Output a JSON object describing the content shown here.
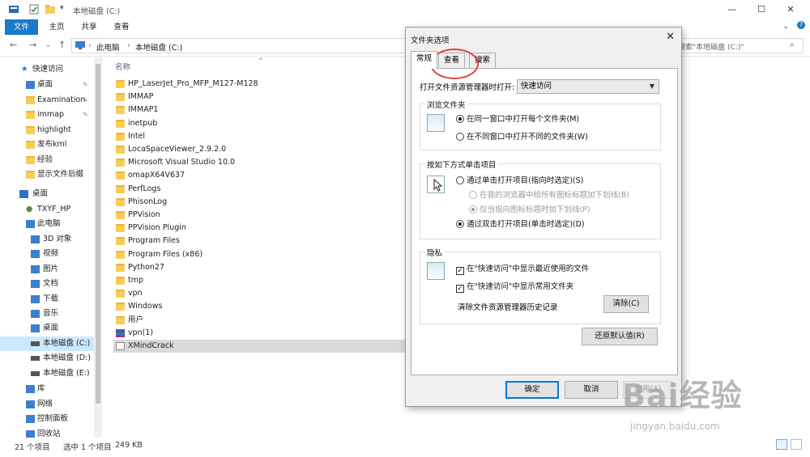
{
  "window": {
    "title": "本地磁盘 (C:)",
    "controls": [
      "—",
      "☐",
      "✕"
    ]
  },
  "ribbon": {
    "tabs": [
      "文件",
      "主页",
      "共享",
      "查看"
    ]
  },
  "address": {
    "crumbs": [
      "此电脑",
      "本地磁盘 (C:)"
    ],
    "search_placeholder": "搜索\"本地磁盘 (C:)\""
  },
  "nav": {
    "quick_access": "快速访问",
    "items": [
      {
        "label": "桌面",
        "pinned": true,
        "icon": "desktop-icon"
      },
      {
        "label": "Examination",
        "pinned": true,
        "icon": "folder-icon"
      },
      {
        "label": "immap",
        "pinned": true,
        "icon": "folder-icon"
      },
      {
        "label": "highlight",
        "pinned": false,
        "icon": "folder-icon"
      },
      {
        "label": "发布kml",
        "pinned": false,
        "icon": "folder-icon"
      },
      {
        "label": "经验",
        "pinned": false,
        "icon": "folder-icon"
      },
      {
        "label": "显示文件后缀",
        "pinned": false,
        "icon": "folder-icon"
      }
    ],
    "desktop": "桌面",
    "user": "TXYF_HP",
    "this_pc": "此电脑",
    "pc_items": [
      {
        "label": "3D 对象",
        "icon": "3d-objects-icon"
      },
      {
        "label": "视频",
        "icon": "video-icon"
      },
      {
        "label": "图片",
        "icon": "pictures-icon"
      },
      {
        "label": "文档",
        "icon": "documents-icon"
      },
      {
        "label": "下载",
        "icon": "download-icon"
      },
      {
        "label": "音乐",
        "icon": "music-icon"
      },
      {
        "label": "桌面",
        "icon": "desktop-icon"
      },
      {
        "label": "本地磁盘 (C:)",
        "icon": "drive-icon"
      },
      {
        "label": "本地磁盘 (D:)",
        "icon": "drive-icon"
      },
      {
        "label": "本地磁盘 (E:)",
        "icon": "drive-icon"
      }
    ],
    "bottom_items": [
      {
        "label": "库",
        "icon": "library-icon"
      },
      {
        "label": "网络",
        "icon": "network-icon"
      },
      {
        "label": "控制面板",
        "icon": "control-panel-icon"
      },
      {
        "label": "回收站",
        "icon": "recycle-bin-icon"
      }
    ]
  },
  "filelist": {
    "column_name": "名称",
    "files": [
      {
        "name": "HP_LaserJet_Pro_MFP_M127-M128",
        "icon": "folder-icon"
      },
      {
        "name": "IMMAP",
        "icon": "folder-icon"
      },
      {
        "name": "IMMAP1",
        "icon": "folder-icon"
      },
      {
        "name": "inetpub",
        "icon": "folder-icon"
      },
      {
        "name": "Intel",
        "icon": "folder-icon"
      },
      {
        "name": "LocaSpaceViewer_2.9.2.0",
        "icon": "folder-icon"
      },
      {
        "name": "Microsoft Visual Studio 10.0",
        "icon": "folder-icon"
      },
      {
        "name": "omapX64V637",
        "icon": "folder-icon"
      },
      {
        "name": "PerfLogs",
        "icon": "folder-icon"
      },
      {
        "name": "PhisonLog",
        "icon": "folder-icon"
      },
      {
        "name": "PPVision",
        "icon": "folder-icon"
      },
      {
        "name": "PPVision Plugin",
        "icon": "folder-icon"
      },
      {
        "name": "Program Files",
        "icon": "folder-icon"
      },
      {
        "name": "Program Files (x86)",
        "icon": "folder-icon"
      },
      {
        "name": "Python27",
        "icon": "folder-icon"
      },
      {
        "name": "tmp",
        "icon": "folder-icon"
      },
      {
        "name": "vpn",
        "icon": "folder-icon"
      },
      {
        "name": "Windows",
        "icon": "folder-icon"
      },
      {
        "name": "用户",
        "icon": "folder-icon"
      },
      {
        "name": "vpn(1)",
        "icon": "archive-icon"
      },
      {
        "name": "XMindCrack",
        "icon": "application-icon"
      }
    ]
  },
  "status": {
    "count": "21 个项目",
    "selected": "选中 1 个项目",
    "size": "249 KB"
  },
  "dialog": {
    "title": "文件夹选项",
    "tabs": [
      "常规",
      "查看",
      "搜索"
    ],
    "open_in_label": "打开文件资源管理器时打开:",
    "open_in_value": "快速访问",
    "browse_group": "浏览文件夹",
    "browse_same": "在同一窗口中打开每个文件夹(M)",
    "browse_new": "在不同窗口中打开不同的文件夹(W)",
    "click_group": "按如下方式单击项目",
    "single_click": "通过单击打开项目(指向时选定)(S)",
    "underline_all": "在我的浏览器中给所有图标标题加下划线(B)",
    "underline_hover": "仅当指向图标标题时加下划线(P)",
    "double_click": "通过双击打开项目(单击时选定)(D)",
    "privacy_group": "隐私",
    "show_recent": "在\"快速访问\"中显示最近使用的文件",
    "show_frequent": "在\"快速访问\"中显示常用文件夹",
    "clear_history_label": "清除文件资源管理器历史记录",
    "clear_button": "清除(C)",
    "restore_button": "还原默认值(R)",
    "ok_button": "确定",
    "cancel_button": "取消",
    "apply_button": "应用(A)"
  },
  "watermark": {
    "brand": "Bai经验",
    "url": "jingyan.baidu.com"
  },
  "colors": {
    "accent": "#1979ca",
    "annotation": "#e0403a"
  }
}
